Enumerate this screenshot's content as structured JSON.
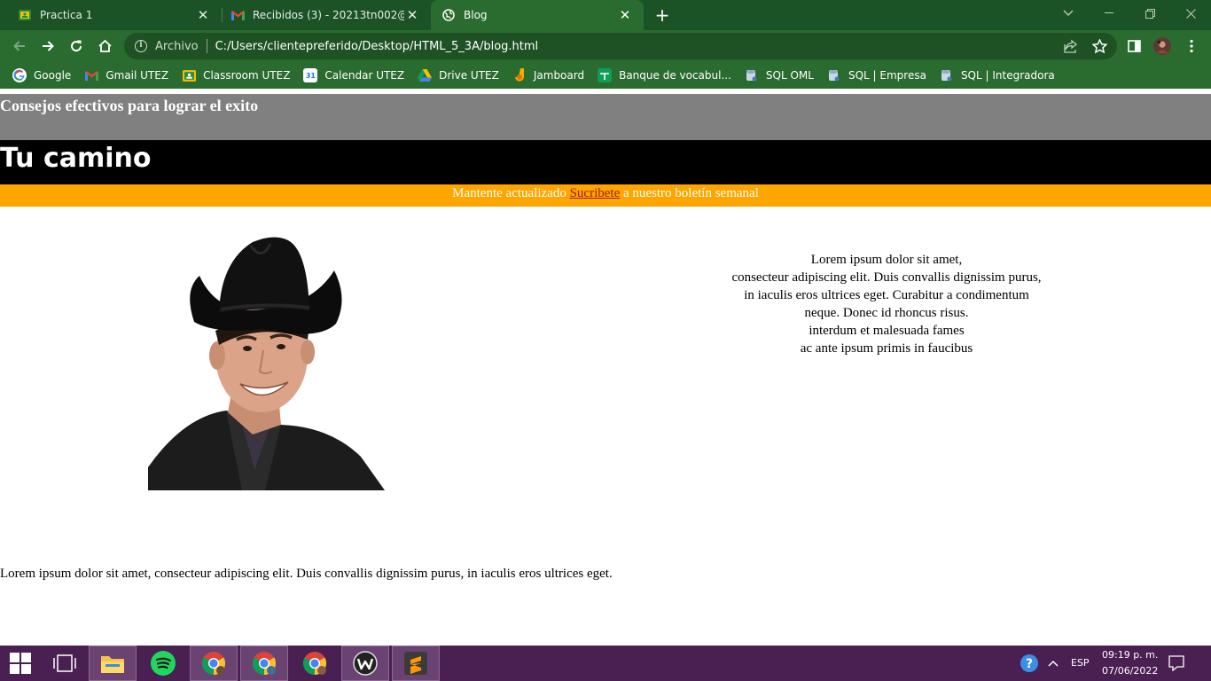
{
  "browser": {
    "tabs": [
      {
        "title": "Practica 1",
        "icon": "classroom-icon",
        "active": false
      },
      {
        "title": "Recibidos (3) - 20213tn002@utez",
        "icon": "gmail-icon",
        "active": false
      },
      {
        "title": "Blog",
        "icon": "globe-icon",
        "active": true
      }
    ],
    "address": {
      "security_label": "Archivo",
      "url": "C:/Users/clientepreferido/Desktop/HTML_5_3A/blog.html"
    },
    "bookmarks": [
      {
        "label": "Google",
        "icon": "google-icon"
      },
      {
        "label": "Gmail UTEZ",
        "icon": "gmail-icon"
      },
      {
        "label": "Classroom UTEZ",
        "icon": "classroom-icon"
      },
      {
        "label": "Calendar UTEZ",
        "icon": "calendar-icon"
      },
      {
        "label": "Drive UTEZ",
        "icon": "drive-icon"
      },
      {
        "label": "Jamboard",
        "icon": "jamboard-icon"
      },
      {
        "label": "Banque de vocabul...",
        "icon": "sheets-icon"
      },
      {
        "label": "SQL OML",
        "icon": "database-icon"
      },
      {
        "label": "SQL | Empresa",
        "icon": "database-icon"
      },
      {
        "label": "SQL | Integradora",
        "icon": "database-icon"
      }
    ]
  },
  "page": {
    "subtitle": "Consejos efectivos para lograr el exito",
    "title": "Tu camino",
    "banner": {
      "before": "Mantente actualizado ",
      "link": "Sucribete",
      "after": " a nuestro boletín semanal"
    },
    "lorem_lines": [
      "Lorem ipsum dolor sit amet,",
      "consecteur adipiscing elit. Duis convallis dignissim purus,",
      "in iaculis eros ultrices eget. Curabitur a condimentum",
      "neque. Donec id rhoncus risus.",
      "interdum et malesuada fames",
      "ac ante ipsum primis in faucibus"
    ],
    "footer_text": "Lorem ipsum dolor sit amet, consecteur adipiscing elit. Duis convallis dignissim purus, in iaculis eros ultrices eget."
  },
  "taskbar": {
    "language": "ESP",
    "time": "09:19 p. m.",
    "date": "07/06/2022"
  },
  "colors": {
    "tabstrip": "#1b5326",
    "toolbar": "#2a6b2f",
    "grey_bar": "#808080",
    "black_bar": "#000000",
    "orange_bar": "#ffa500",
    "taskbar": "#4a1f52"
  }
}
